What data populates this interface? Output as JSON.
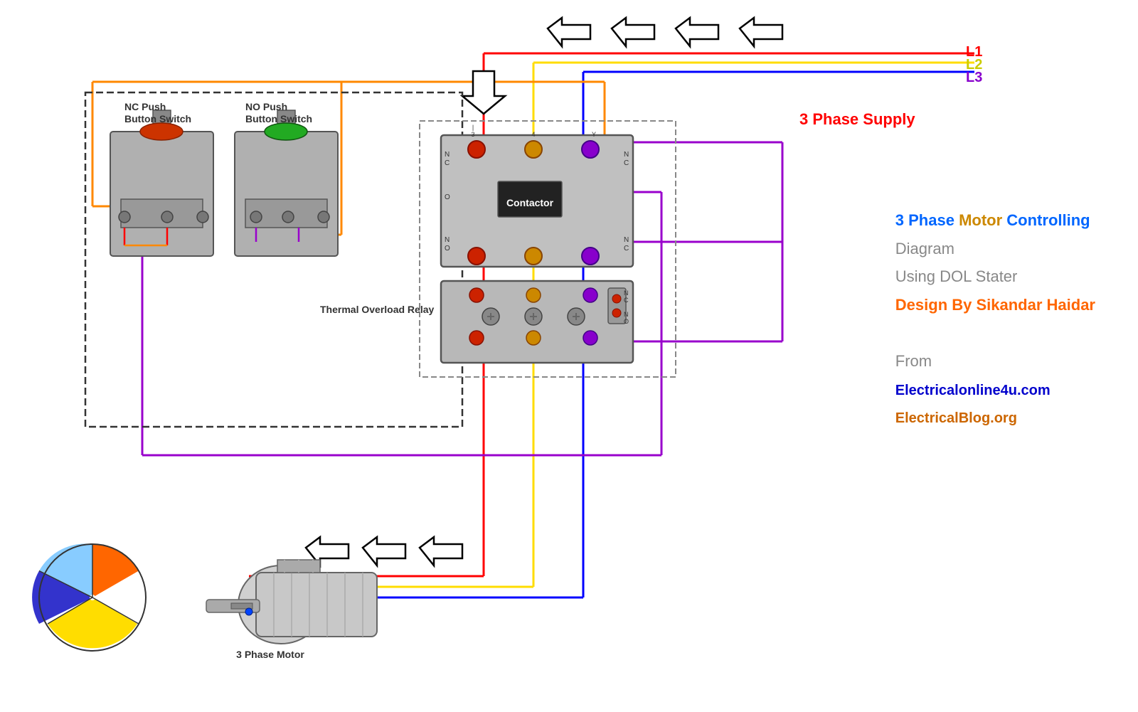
{
  "title": "3 Phase Motor Controlling Diagram Using DOL Stater",
  "supply_label": "3 Phase Supply",
  "l1": "L1",
  "l2": "L2",
  "l3": "L3",
  "nc_push_button": "NC Push\nButton Switch",
  "no_push_button": "NO Push\nButton Switch",
  "contactor_label": "Contactor",
  "thermal_relay_label": "Thermal Overload Relay",
  "motor_label": "3 Phase Motor",
  "title_line1_blue": "3 Phase",
  "title_line1_orange": "Motor",
  "title_line1_gray": "Controlling",
  "title_line2": "Diagram",
  "title_line3": "Using DOL Stater",
  "title_line4": "Design By Sikandar Haidar",
  "from_label": "From",
  "website1": "Electricalonline4u.com",
  "website2": "ElectricalBlog.org",
  "colors": {
    "red": "#ff0000",
    "yellow": "#ffff00",
    "blue": "#0000ff",
    "purple": "#8800cc",
    "orange": "#ff8800",
    "accent_blue": "#0066ff",
    "accent_orange": "#ff6600",
    "gray": "#888888"
  }
}
